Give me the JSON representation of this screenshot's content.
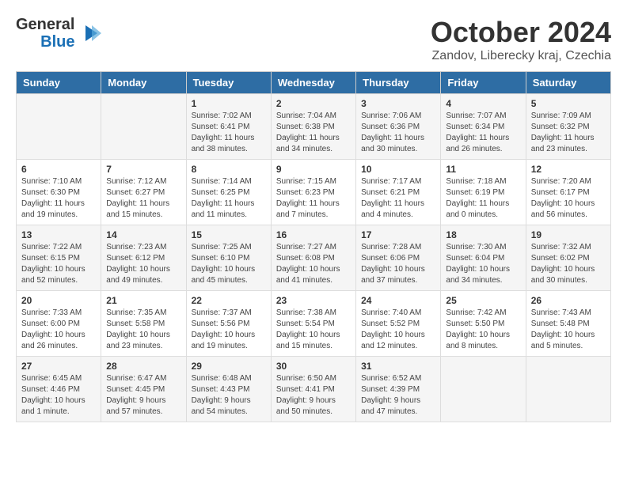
{
  "header": {
    "logo_line1": "General",
    "logo_line2": "Blue",
    "month": "October 2024",
    "location": "Zandov, Liberecky kraj, Czechia"
  },
  "weekdays": [
    "Sunday",
    "Monday",
    "Tuesday",
    "Wednesday",
    "Thursday",
    "Friday",
    "Saturday"
  ],
  "weeks": [
    [
      {
        "day": "",
        "info": ""
      },
      {
        "day": "",
        "info": ""
      },
      {
        "day": "1",
        "info": "Sunrise: 7:02 AM\nSunset: 6:41 PM\nDaylight: 11 hours and 38 minutes."
      },
      {
        "day": "2",
        "info": "Sunrise: 7:04 AM\nSunset: 6:38 PM\nDaylight: 11 hours and 34 minutes."
      },
      {
        "day": "3",
        "info": "Sunrise: 7:06 AM\nSunset: 6:36 PM\nDaylight: 11 hours and 30 minutes."
      },
      {
        "day": "4",
        "info": "Sunrise: 7:07 AM\nSunset: 6:34 PM\nDaylight: 11 hours and 26 minutes."
      },
      {
        "day": "5",
        "info": "Sunrise: 7:09 AM\nSunset: 6:32 PM\nDaylight: 11 hours and 23 minutes."
      }
    ],
    [
      {
        "day": "6",
        "info": "Sunrise: 7:10 AM\nSunset: 6:30 PM\nDaylight: 11 hours and 19 minutes."
      },
      {
        "day": "7",
        "info": "Sunrise: 7:12 AM\nSunset: 6:27 PM\nDaylight: 11 hours and 15 minutes."
      },
      {
        "day": "8",
        "info": "Sunrise: 7:14 AM\nSunset: 6:25 PM\nDaylight: 11 hours and 11 minutes."
      },
      {
        "day": "9",
        "info": "Sunrise: 7:15 AM\nSunset: 6:23 PM\nDaylight: 11 hours and 7 minutes."
      },
      {
        "day": "10",
        "info": "Sunrise: 7:17 AM\nSunset: 6:21 PM\nDaylight: 11 hours and 4 minutes."
      },
      {
        "day": "11",
        "info": "Sunrise: 7:18 AM\nSunset: 6:19 PM\nDaylight: 11 hours and 0 minutes."
      },
      {
        "day": "12",
        "info": "Sunrise: 7:20 AM\nSunset: 6:17 PM\nDaylight: 10 hours and 56 minutes."
      }
    ],
    [
      {
        "day": "13",
        "info": "Sunrise: 7:22 AM\nSunset: 6:15 PM\nDaylight: 10 hours and 52 minutes."
      },
      {
        "day": "14",
        "info": "Sunrise: 7:23 AM\nSunset: 6:12 PM\nDaylight: 10 hours and 49 minutes."
      },
      {
        "day": "15",
        "info": "Sunrise: 7:25 AM\nSunset: 6:10 PM\nDaylight: 10 hours and 45 minutes."
      },
      {
        "day": "16",
        "info": "Sunrise: 7:27 AM\nSunset: 6:08 PM\nDaylight: 10 hours and 41 minutes."
      },
      {
        "day": "17",
        "info": "Sunrise: 7:28 AM\nSunset: 6:06 PM\nDaylight: 10 hours and 37 minutes."
      },
      {
        "day": "18",
        "info": "Sunrise: 7:30 AM\nSunset: 6:04 PM\nDaylight: 10 hours and 34 minutes."
      },
      {
        "day": "19",
        "info": "Sunrise: 7:32 AM\nSunset: 6:02 PM\nDaylight: 10 hours and 30 minutes."
      }
    ],
    [
      {
        "day": "20",
        "info": "Sunrise: 7:33 AM\nSunset: 6:00 PM\nDaylight: 10 hours and 26 minutes."
      },
      {
        "day": "21",
        "info": "Sunrise: 7:35 AM\nSunset: 5:58 PM\nDaylight: 10 hours and 23 minutes."
      },
      {
        "day": "22",
        "info": "Sunrise: 7:37 AM\nSunset: 5:56 PM\nDaylight: 10 hours and 19 minutes."
      },
      {
        "day": "23",
        "info": "Sunrise: 7:38 AM\nSunset: 5:54 PM\nDaylight: 10 hours and 15 minutes."
      },
      {
        "day": "24",
        "info": "Sunrise: 7:40 AM\nSunset: 5:52 PM\nDaylight: 10 hours and 12 minutes."
      },
      {
        "day": "25",
        "info": "Sunrise: 7:42 AM\nSunset: 5:50 PM\nDaylight: 10 hours and 8 minutes."
      },
      {
        "day": "26",
        "info": "Sunrise: 7:43 AM\nSunset: 5:48 PM\nDaylight: 10 hours and 5 minutes."
      }
    ],
    [
      {
        "day": "27",
        "info": "Sunrise: 6:45 AM\nSunset: 4:46 PM\nDaylight: 10 hours and 1 minute."
      },
      {
        "day": "28",
        "info": "Sunrise: 6:47 AM\nSunset: 4:45 PM\nDaylight: 9 hours and 57 minutes."
      },
      {
        "day": "29",
        "info": "Sunrise: 6:48 AM\nSunset: 4:43 PM\nDaylight: 9 hours and 54 minutes."
      },
      {
        "day": "30",
        "info": "Sunrise: 6:50 AM\nSunset: 4:41 PM\nDaylight: 9 hours and 50 minutes."
      },
      {
        "day": "31",
        "info": "Sunrise: 6:52 AM\nSunset: 4:39 PM\nDaylight: 9 hours and 47 minutes."
      },
      {
        "day": "",
        "info": ""
      },
      {
        "day": "",
        "info": ""
      }
    ]
  ]
}
